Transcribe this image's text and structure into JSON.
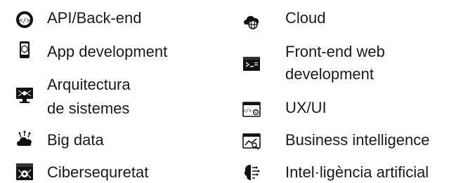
{
  "services": [
    {
      "label": "API/Back-end",
      "icon": "api-code-icon"
    },
    {
      "label": "App development",
      "icon": "mobile-app-icon"
    },
    {
      "label_line1": "Arquitectura",
      "label_line2": "de sistemes",
      "icon": "system-architecture-icon"
    },
    {
      "label": "Big data",
      "icon": "big-data-icon"
    },
    {
      "label": "Cibersequretat",
      "icon": "cybersecurity-icon"
    },
    {
      "label": "Cloud",
      "icon": "cloud-globe-icon"
    },
    {
      "label_line1": "Front-end web",
      "label_line2": "development",
      "icon": "frontend-terminal-icon"
    },
    {
      "label": "UX/UI",
      "icon": "ux-ui-window-icon"
    },
    {
      "label": "Business intelligence",
      "icon": "business-intelligence-icon"
    },
    {
      "label": "Intel·ligència artificial",
      "icon": "ai-brain-icon"
    }
  ],
  "colors": {
    "text": "#1a1a1a",
    "icon": "#111111"
  }
}
